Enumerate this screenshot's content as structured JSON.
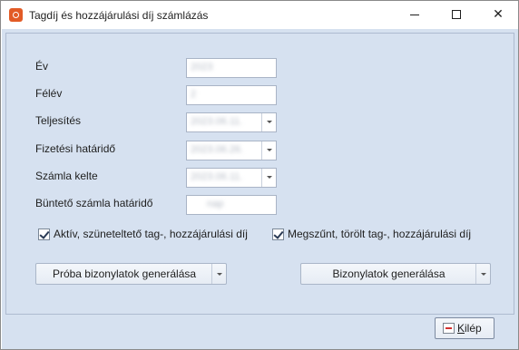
{
  "window": {
    "title": "Tagdíj és hozzájárulási díj számlázás",
    "controls": {
      "minimize": "minimize",
      "maximize": "maximize",
      "close": "✕"
    }
  },
  "form": {
    "fields": [
      {
        "label": "Év",
        "value": "2023",
        "type": "text"
      },
      {
        "label": "Félév",
        "value": "2",
        "type": "text"
      },
      {
        "label": "Teljesítés",
        "value": "2023.06.11.",
        "type": "date"
      },
      {
        "label": "Fizetési határidő",
        "value": "2023.06.26.",
        "type": "date"
      },
      {
        "label": "Számla kelte",
        "value": "2023.06.11.",
        "type": "date"
      },
      {
        "label": "Büntető számla határidő",
        "value": "nap",
        "type": "text"
      }
    ],
    "checkboxes": [
      {
        "label": "Aktív, szüneteltető tag-, hozzájárulási díj",
        "checked": true
      },
      {
        "label": "Megszűnt, törölt tag-, hozzájárulási díj",
        "checked": true
      }
    ],
    "buttons": {
      "preview": "Próba bizonylatok generálása",
      "generate": "Bizonylatok generálása"
    }
  },
  "footer": {
    "exit_prefix": "",
    "exit_underlined": "K",
    "exit_rest": "ilép"
  },
  "colors": {
    "content_bg": "#d6e1f0",
    "app_icon": "#e25b26"
  }
}
